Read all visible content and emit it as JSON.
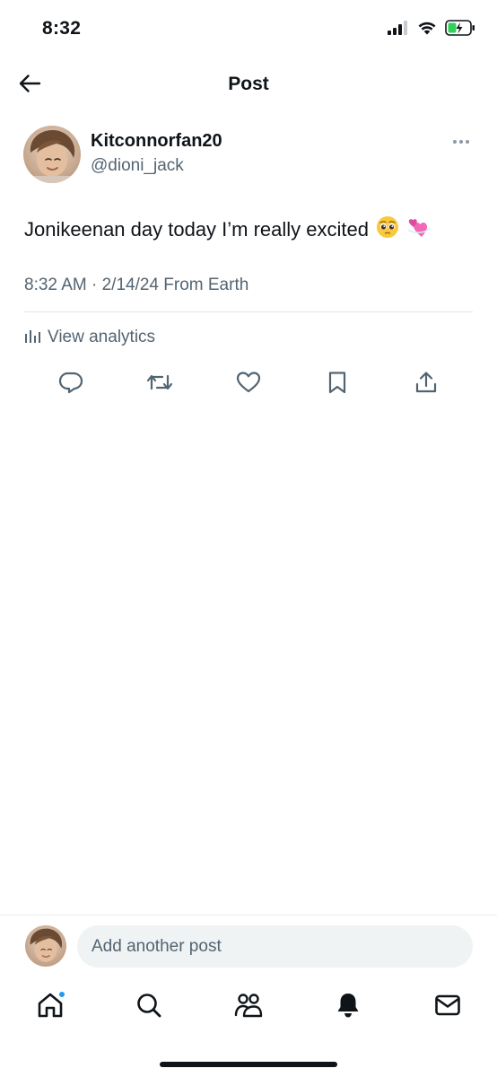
{
  "status_bar": {
    "time": "8:32",
    "icons": [
      "cellular-signal-icon",
      "wifi-icon",
      "battery-charging-icon"
    ]
  },
  "header": {
    "title": "Post",
    "back_icon": "arrow-left-icon"
  },
  "post": {
    "display_name": "Kitconnorfan20",
    "handle": "@dioni_jack",
    "text": "Jonikeenan day today I’m really excited",
    "emojis": [
      "🥺",
      "💞"
    ],
    "timestamp": "8:32 AM · 2/14/24",
    "location": "From Earth",
    "analytics_label": "View analytics",
    "actions": [
      "reply-icon",
      "repost-icon",
      "like-icon",
      "bookmark-icon",
      "share-icon"
    ]
  },
  "reply": {
    "placeholder": "Add another post"
  },
  "tabbar": {
    "tabs": [
      "home-icon",
      "search-icon",
      "communities-icon",
      "notifications-icon",
      "messages-icon"
    ],
    "home_has_notification": true
  },
  "colors": {
    "accent": "#1d9bf0",
    "text_primary": "#0f1419",
    "text_secondary": "#536471",
    "input_bg": "#eff3f4"
  }
}
